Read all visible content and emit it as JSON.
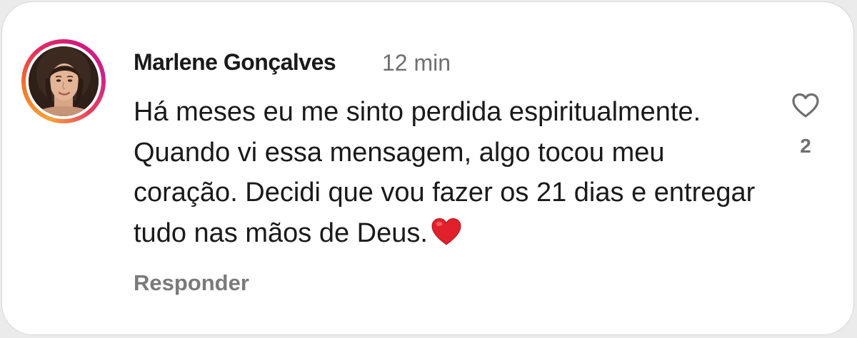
{
  "comment": {
    "author": "Marlene Gonçalves",
    "time": "12 min",
    "text": "Há meses eu me sinto perdida espiritualmente. Quando vi essa mensagem, algo tocou meu coração. Decidi que vou fazer os 21 dias e entregar tudo nas mãos de Deus.",
    "emoji": "red-heart-emoji",
    "like_count": "2",
    "reply_label": "Responder",
    "like_icon": "heart-outline-icon",
    "has_story_ring": true
  },
  "colors": {
    "username": "#1a1a1a",
    "secondary": "#6f6f6f",
    "ring_start": "#f9a23a",
    "ring_end": "#c7238f",
    "emoji_heart": "#e0212c"
  }
}
